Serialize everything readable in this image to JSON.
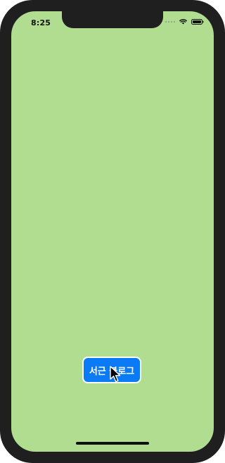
{
  "status_bar": {
    "time": "8:25",
    "icons": [
      "signal-icon",
      "wifi-icon",
      "battery-icon"
    ]
  },
  "main": {
    "background_color": "#b1dd90",
    "button": {
      "label": "서근 블로그",
      "color": "#0a7af5"
    },
    "pointer": "cursor-icon"
  }
}
